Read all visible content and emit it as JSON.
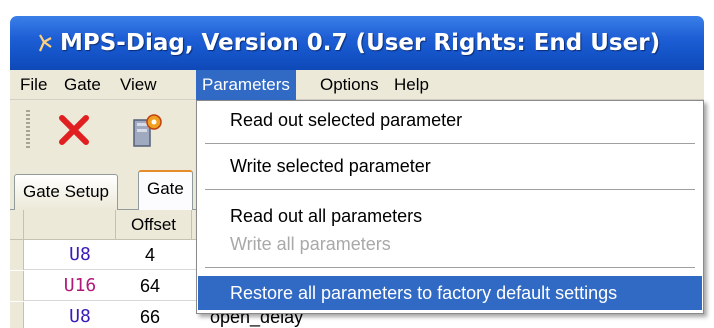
{
  "window": {
    "title": "MPS-Diag, Version 0.7 (User Rights: End User)"
  },
  "menubar": {
    "items": [
      {
        "label": "File"
      },
      {
        "label": "Gate"
      },
      {
        "label": "View"
      },
      {
        "label": "Parameters"
      },
      {
        "label": "Options"
      },
      {
        "label": "Help"
      }
    ],
    "active": "Parameters"
  },
  "toolbar": {
    "icons": [
      "delete-x-icon",
      "computer-settings-icon"
    ]
  },
  "tabs": [
    {
      "label": "Gate Setup"
    },
    {
      "label": "Gate"
    }
  ],
  "grid": {
    "headers": {
      "offset": "Offset"
    },
    "rows": [
      {
        "type": "U8",
        "type_color": "#3a1ab8",
        "offset": "4",
        "name": ""
      },
      {
        "type": "U16",
        "type_color": "#b01a7a",
        "offset": "64",
        "name": ""
      },
      {
        "type": "U8",
        "type_color": "#3a1ab8",
        "offset": "66",
        "name": "open_delay"
      }
    ]
  },
  "parameters_menu": {
    "items": [
      {
        "label": "Read out selected parameter",
        "enabled": true
      },
      {
        "label": "Write selected parameter",
        "enabled": true
      },
      {
        "label": "Read out all parameters",
        "enabled": true
      },
      {
        "label": "Write all parameters",
        "enabled": false
      },
      {
        "label": "Restore all parameters to factory default settings",
        "enabled": true,
        "highlighted": true
      }
    ]
  },
  "colors": {
    "titlebar": "#1f5fd6",
    "menu_highlight": "#316ac5",
    "chrome": "#ece9d8",
    "type_u8": "#3a1ab8",
    "type_u16": "#b01a7a",
    "delete_red": "#e02020"
  }
}
